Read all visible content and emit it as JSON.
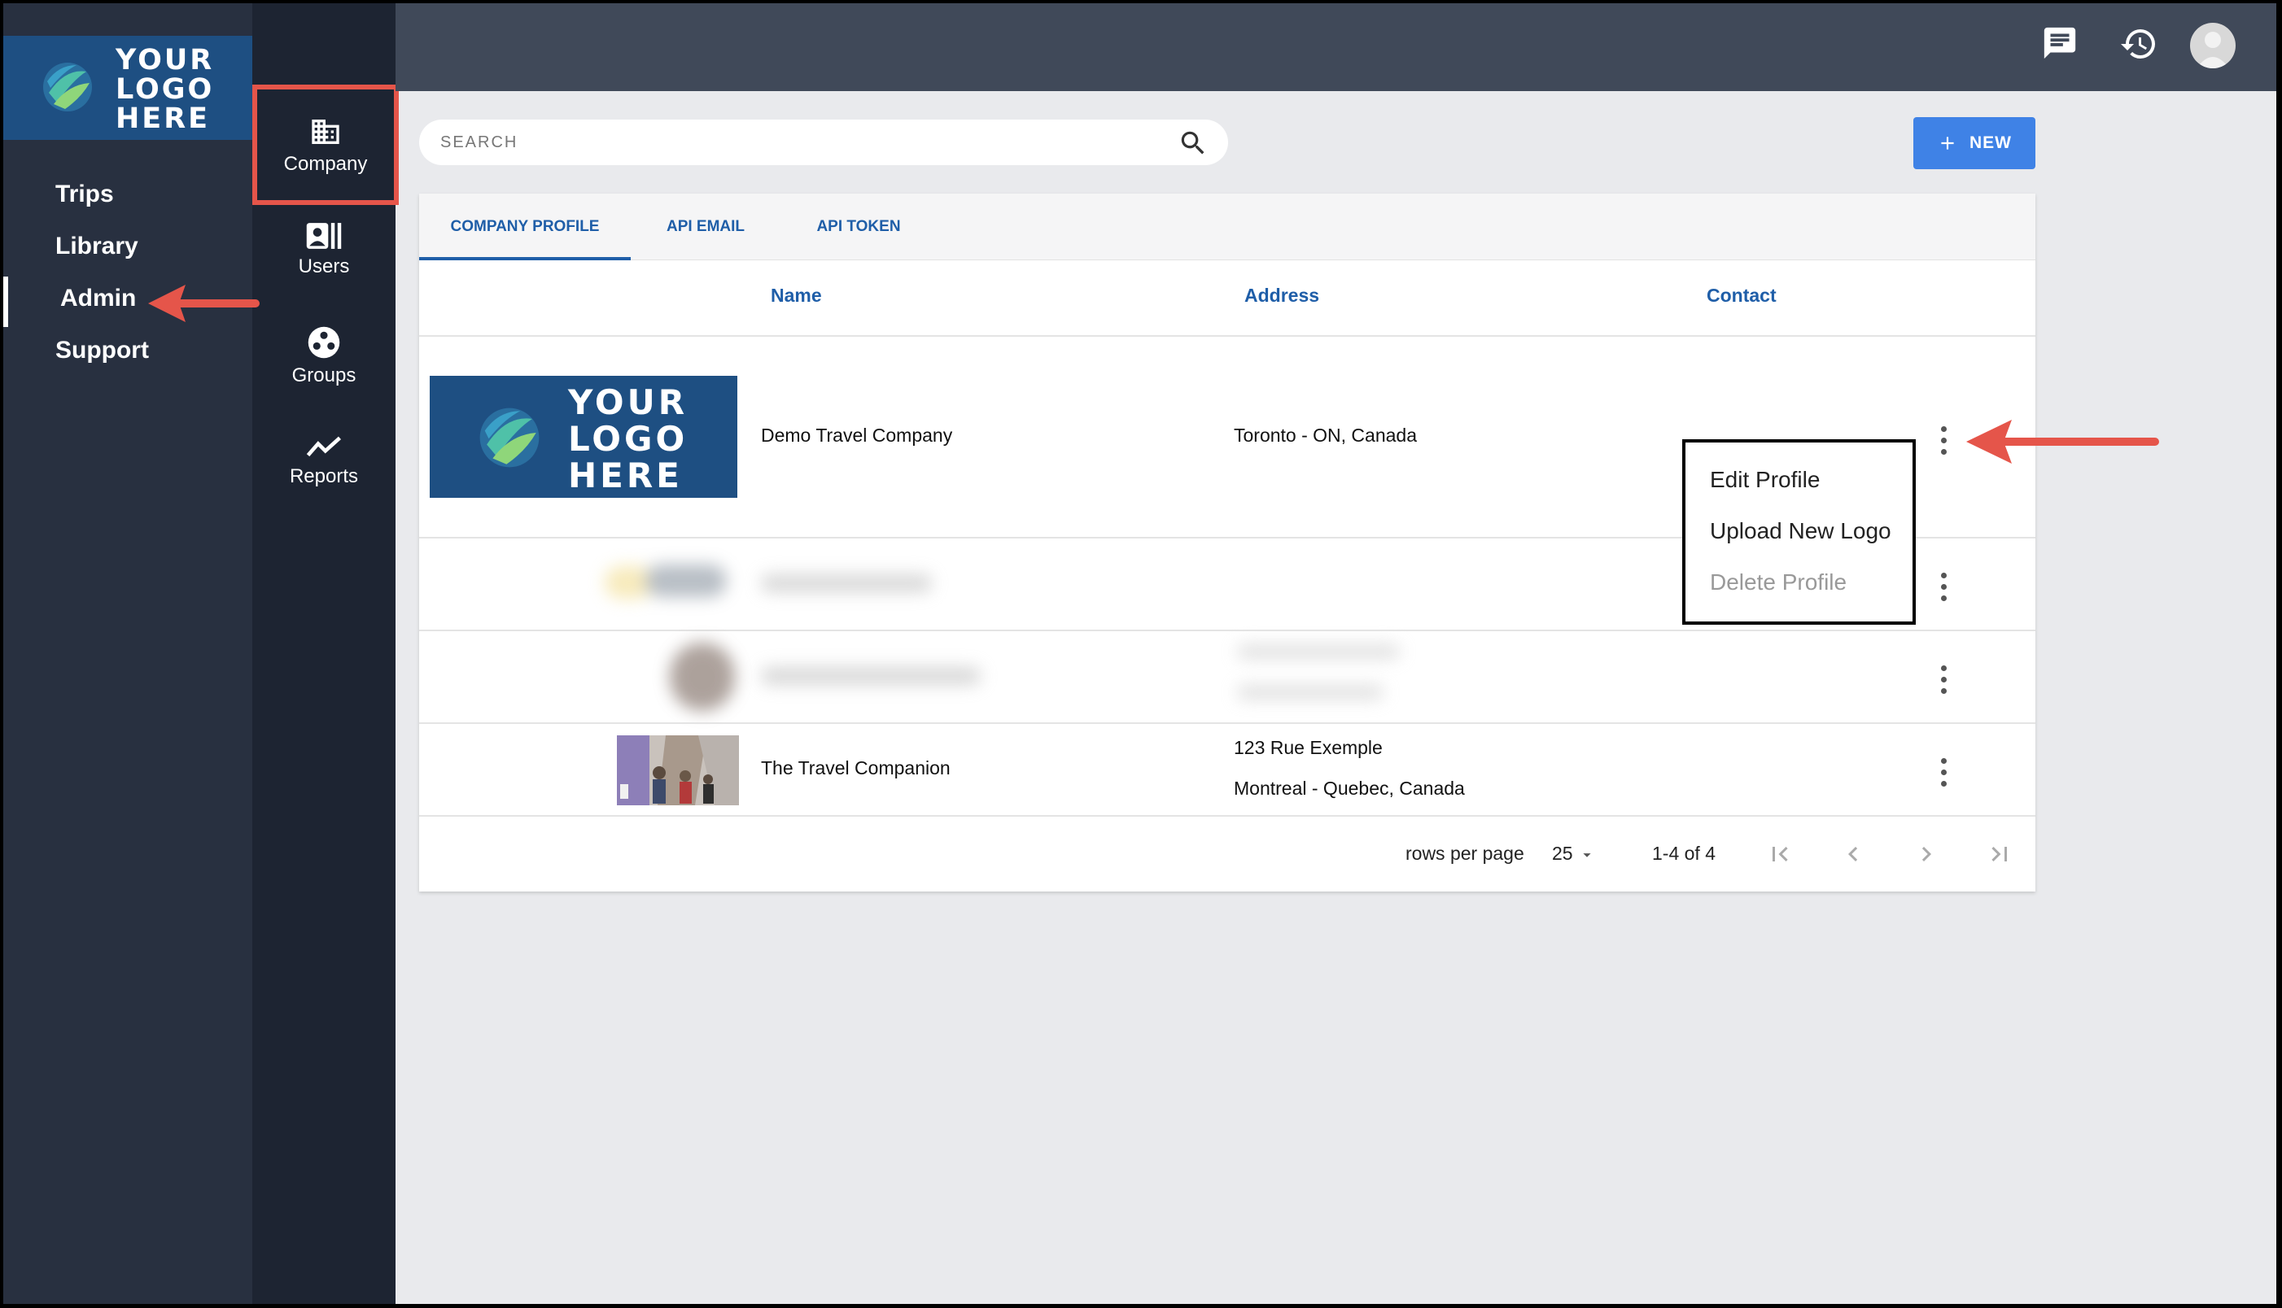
{
  "logo": {
    "lines": [
      "YOUR",
      "LOGO",
      "HERE"
    ]
  },
  "nav": {
    "items": [
      {
        "label": "Trips"
      },
      {
        "label": "Library"
      },
      {
        "label": "Admin"
      },
      {
        "label": "Support"
      }
    ],
    "active": "Admin"
  },
  "rail": {
    "items": [
      {
        "label": "Company",
        "icon": "company-icon"
      },
      {
        "label": "Users",
        "icon": "users-icon"
      },
      {
        "label": "Groups",
        "icon": "groups-icon"
      },
      {
        "label": "Reports",
        "icon": "reports-icon"
      }
    ],
    "active": "Company"
  },
  "topbar": {
    "icons": [
      "chat-icon",
      "history-icon",
      "avatar"
    ]
  },
  "search": {
    "placeholder": "SEARCH"
  },
  "new_button": {
    "label": "NEW"
  },
  "tabs": [
    {
      "label": "COMPANY PROFILE",
      "active": true
    },
    {
      "label": "API EMAIL",
      "active": false
    },
    {
      "label": "API TOKEN",
      "active": false
    }
  ],
  "table": {
    "columns": [
      "Name",
      "Address",
      "Contact"
    ],
    "rows": [
      {
        "name": "Demo Travel Company",
        "address_line1": "Toronto - ON, Canada",
        "address_line2": "",
        "logo": "your-logo-here"
      },
      {
        "name": "",
        "address_line1": "",
        "address_line2": "",
        "logo": "blurred"
      },
      {
        "name": "",
        "address_line1": "",
        "address_line2": "",
        "logo": "blurred"
      },
      {
        "name": "The Travel Companion",
        "address_line1": "123 Rue Exemple",
        "address_line2": "Montreal - Quebec, Canada",
        "logo": "photo"
      }
    ]
  },
  "pagination": {
    "rows_per_page_label": "rows per page",
    "rows_per_page": "25",
    "range": "1-4 of 4"
  },
  "context_menu": {
    "items": [
      {
        "label": "Edit Profile",
        "disabled": false
      },
      {
        "label": "Upload New Logo",
        "disabled": false
      },
      {
        "label": "Delete Profile",
        "disabled": true
      }
    ]
  },
  "colors": {
    "sidebar": "#283040",
    "rail": "#1d2432",
    "topbar": "#404959",
    "accent": "#1f5ea8",
    "new_button": "#3f82e6",
    "highlight": "#e5554a"
  }
}
